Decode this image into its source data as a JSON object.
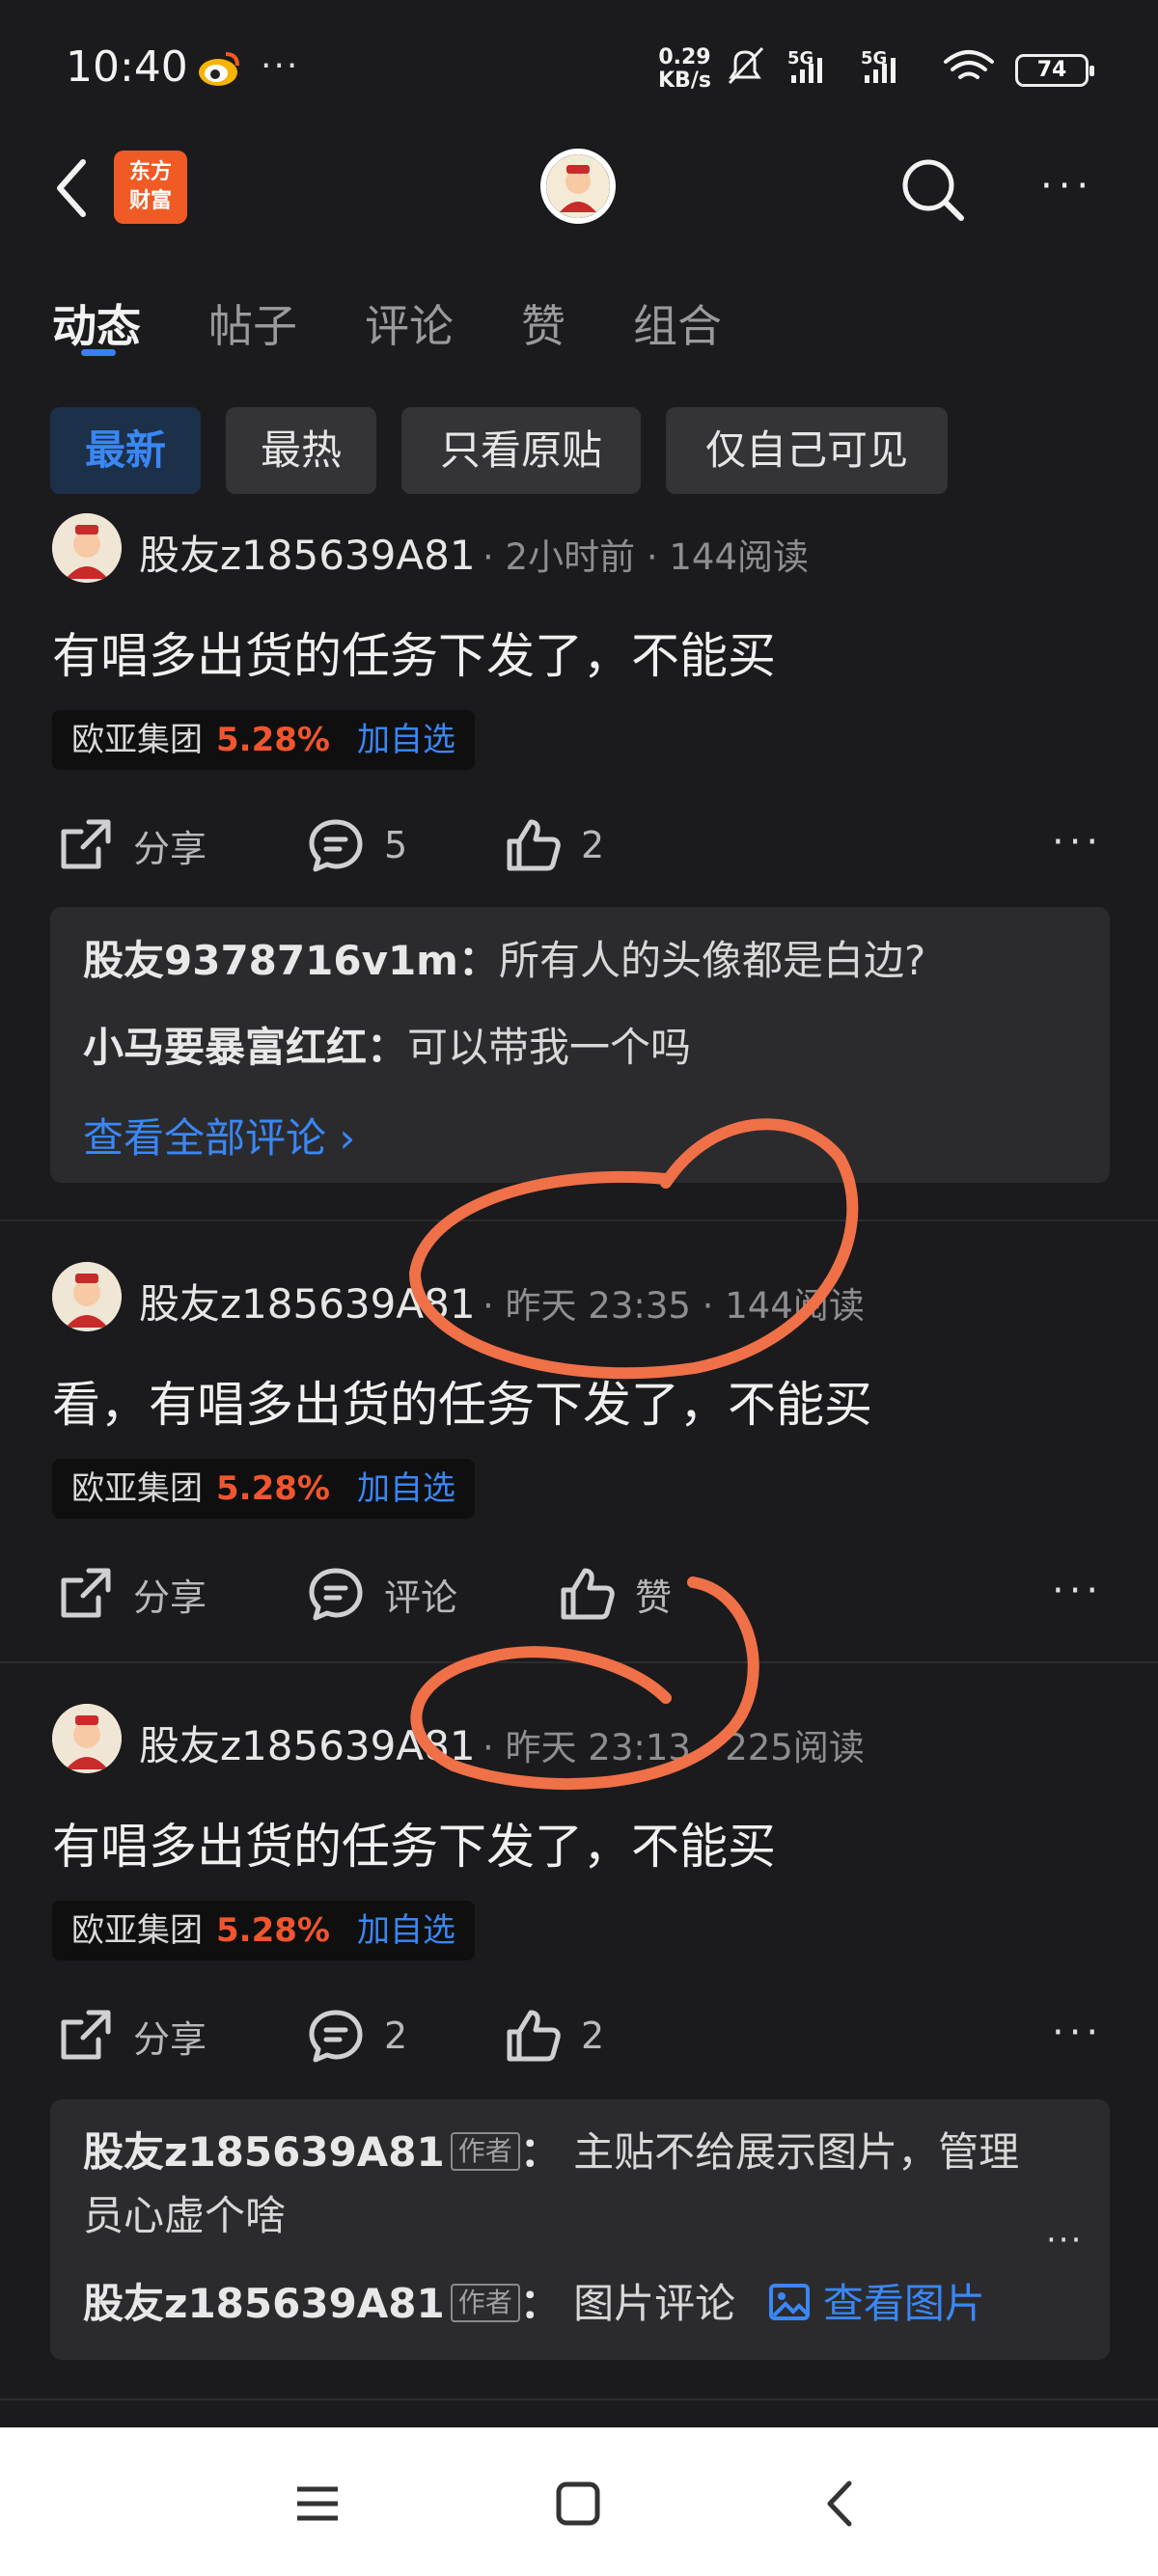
{
  "status": {
    "time": "10:40",
    "dots": "···",
    "net_speed_value": "0.29",
    "net_speed_unit": "KB/s",
    "battery": "74"
  },
  "header": {
    "logo_line1": "东方",
    "logo_line2": "财富",
    "more": "···"
  },
  "tabs": [
    {
      "label": "动态"
    },
    {
      "label": "帖子"
    },
    {
      "label": "评论"
    },
    {
      "label": "赞"
    },
    {
      "label": "组合"
    }
  ],
  "filters": [
    {
      "label": "最新"
    },
    {
      "label": "最热"
    },
    {
      "label": "只看原贴"
    },
    {
      "label": "仅自己可见"
    }
  ],
  "posts": [
    {
      "user": "股友z185639A81",
      "time": "2小时前",
      "reads": "144阅读",
      "content": "有唱多出货的任务下发了，不能买",
      "stock": {
        "name": "欧亚集团",
        "change": "5.28%",
        "add": "加自选"
      },
      "share": "分享",
      "comments": "5",
      "likes": "2",
      "comment_list": [
        {
          "user": "股友9378716v1m",
          "text": "所有人的头像都是白边?"
        },
        {
          "user": "小马要暴富红红",
          "text": "可以带我一个吗"
        }
      ],
      "view_all": "查看全部评论 ›"
    },
    {
      "user": "股友z185639A81",
      "time": "昨天 23:35",
      "reads": "144阅读",
      "content": "看，有唱多出货的任务下发了，不能买",
      "stock": {
        "name": "欧亚集团",
        "change": "5.28%",
        "add": "加自选"
      },
      "share": "分享",
      "comments": "评论",
      "likes": "赞"
    },
    {
      "user": "股友z185639A81",
      "time": "昨天 23:13",
      "reads": "225阅读",
      "content": "有唱多出货的任务下发了，不能买",
      "stock": {
        "name": "欧亚集团",
        "change": "5.28%",
        "add": "加自选"
      },
      "share": "分享",
      "comments": "2",
      "likes": "2",
      "comment_list": [
        {
          "user": "股友z185639A81",
          "badge": "作者",
          "text": "主贴不给展示图片，管理员心虚个啥"
        },
        {
          "user": "股友z185639A81",
          "badge": "作者",
          "text": "图片评论",
          "link": "查看图片"
        }
      ],
      "comment_more": "···"
    }
  ],
  "colors": {
    "accent": "#3a87f5",
    "rise": "#f0552e",
    "annotation": "#f07048",
    "background": "#1b1b1d"
  }
}
